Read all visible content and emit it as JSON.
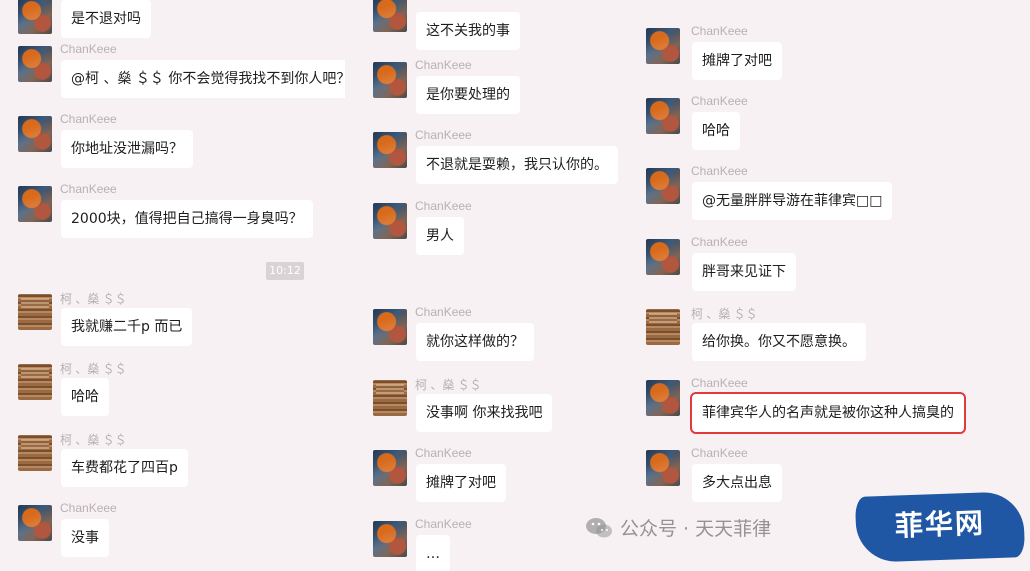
{
  "timestamp": "10:12",
  "watermark": "公众号 · 天天菲律",
  "logo_text": "菲华网",
  "highlight_color": "#e03a3a",
  "columns": [
    {
      "messages": [
        {
          "sender": "",
          "text": "是不退对吗",
          "avatar": "chan"
        },
        {
          "sender": "ChanKeee",
          "text": "@柯 、燊 ＄＄ 你不会觉得我找不到你人吧？",
          "avatar": "chan"
        },
        {
          "sender": "ChanKeee",
          "text": "你地址没泄漏吗？",
          "avatar": "chan"
        },
        {
          "sender": "ChanKeee",
          "text": "2000块，值得把自己搞得一身臭吗？",
          "avatar": "chan"
        },
        {
          "sender": "柯 、燊 ＄＄",
          "text": "我就赚二千p 而已",
          "avatar": "ke"
        },
        {
          "sender": "柯 、燊 ＄＄",
          "text": "哈哈",
          "avatar": "ke"
        },
        {
          "sender": "柯 、燊 ＄＄",
          "text": "车费都花了四百p",
          "avatar": "ke"
        },
        {
          "sender": "ChanKeee",
          "text": "没事",
          "avatar": "chan"
        }
      ]
    },
    {
      "messages": [
        {
          "sender": "",
          "text": "这不关我的事",
          "avatar": "chan"
        },
        {
          "sender": "ChanKeee",
          "text": "是你要处理的",
          "avatar": "chan"
        },
        {
          "sender": "ChanKeee",
          "text": "不退就是耍赖，我只认你的。",
          "avatar": "chan"
        },
        {
          "sender": "ChanKeee",
          "text": "男人",
          "avatar": "chan"
        },
        {
          "sender": "ChanKeee",
          "text": "就你这样做的？",
          "avatar": "chan"
        },
        {
          "sender": "柯 、燊 ＄＄",
          "text": "没事啊 你来找我吧",
          "avatar": "ke"
        },
        {
          "sender": "ChanKeee",
          "text": "摊牌了对吧",
          "avatar": "chan"
        },
        {
          "sender": "ChanKeee",
          "text": "…",
          "avatar": "chan"
        }
      ]
    },
    {
      "messages": [
        {
          "sender": "ChanKeee",
          "text": "摊牌了对吧",
          "avatar": "chan"
        },
        {
          "sender": "ChanKeee",
          "text": "哈哈",
          "avatar": "chan"
        },
        {
          "sender": "ChanKeee",
          "text": "@无量胖胖导游在菲律宾□□",
          "avatar": "chan"
        },
        {
          "sender": "ChanKeee",
          "text": "胖哥来见证下",
          "avatar": "chan"
        },
        {
          "sender": "柯 、燊 ＄＄",
          "text": "给你换。你又不愿意换。",
          "avatar": "ke"
        },
        {
          "sender": "ChanKeee",
          "text": "菲律宾华人的名声就是被你这种人搞臭的",
          "avatar": "chan",
          "highlight": true
        },
        {
          "sender": "ChanKeee",
          "text": "多大点出息",
          "avatar": "chan"
        }
      ]
    }
  ]
}
